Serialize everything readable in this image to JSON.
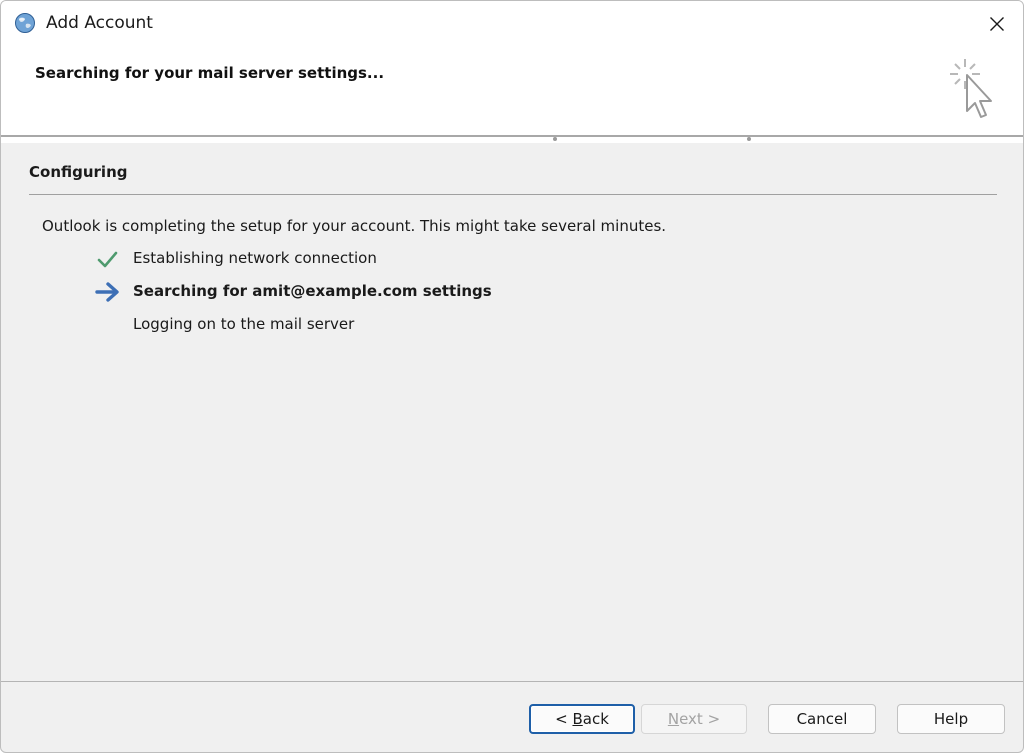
{
  "window": {
    "title": "Add Account",
    "icon": "outlook-globe-icon",
    "close_icon": "close-icon"
  },
  "header": {
    "heading": "Searching for your mail server settings...",
    "graphic": "cursor-click-icon"
  },
  "section": {
    "title": "Configuring"
  },
  "intro": "Outlook is completing the setup for your account. This might take several minutes.",
  "steps": [
    {
      "label": "Establishing network connection",
      "status": "done",
      "icon": "checkmark-icon",
      "color": "#4e9a6e"
    },
    {
      "label": "Searching for amit@example.com settings",
      "status": "in-progress",
      "icon": "arrow-right-icon",
      "color": "#3d6fb5"
    },
    {
      "label": "Logging on to the mail server",
      "status": "pending",
      "icon": "",
      "color": ""
    }
  ],
  "buttons": {
    "back": {
      "prefix": "< ",
      "mnemonic": "B",
      "rest": "ack",
      "enabled": true,
      "focused": true
    },
    "next": {
      "mnemonic": "N",
      "rest": "ext >",
      "enabled": false
    },
    "cancel": {
      "label": "Cancel"
    },
    "help": {
      "label": "Help"
    }
  }
}
